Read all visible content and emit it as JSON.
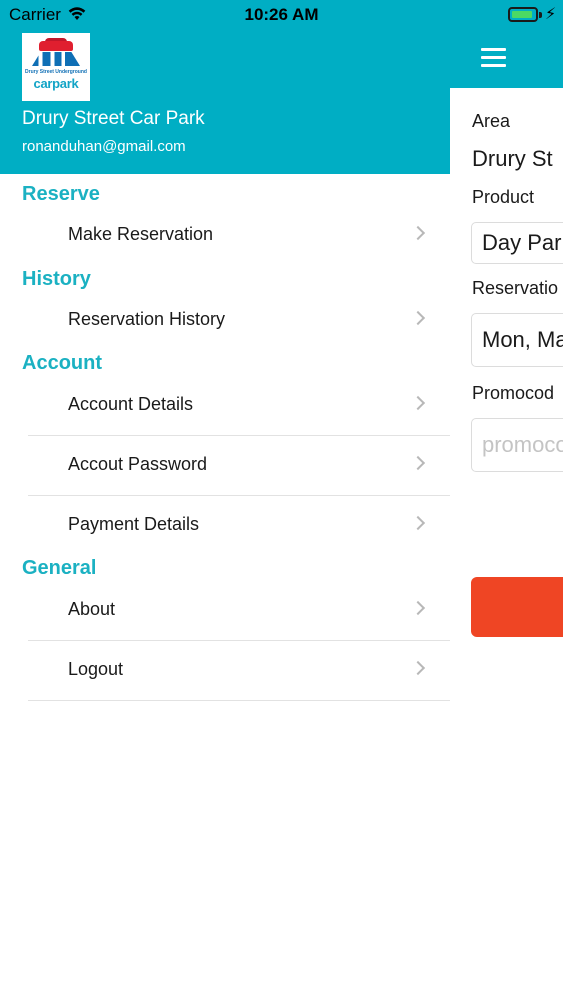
{
  "status_bar": {
    "carrier": "Carrier",
    "time": "10:26 AM",
    "battery_level": 0.85,
    "charging": true
  },
  "drawer": {
    "header": {
      "logo_caption": "Drury Street Underground",
      "logo_word": "carpark",
      "title": "Drury Street Car Park",
      "email": "ronanduhan@gmail.com"
    },
    "sections": {
      "reserve": {
        "title": "Reserve",
        "items": [
          {
            "label": "Make Reservation"
          }
        ]
      },
      "history": {
        "title": "History",
        "items": [
          {
            "label": "Reservation History"
          }
        ]
      },
      "account": {
        "title": "Account",
        "items": [
          {
            "label": "Account Details"
          },
          {
            "label": "Accout Password"
          },
          {
            "label": "Payment Details"
          }
        ]
      },
      "general": {
        "title": "General",
        "items": [
          {
            "label": "About"
          },
          {
            "label": "Logout"
          }
        ]
      }
    }
  },
  "main": {
    "area_label": "Area",
    "area_value": "Drury St",
    "product_label": "Product",
    "product_value": "Day Par",
    "reservation_label": "Reservatio",
    "reservation_value": "Mon, Ma",
    "promocode_label": "Promocod",
    "promocode_placeholder": "promoco"
  },
  "colors": {
    "header_teal": "#00aec4",
    "section_teal": "#1bb1c2",
    "submit_red": "#ef4524"
  }
}
